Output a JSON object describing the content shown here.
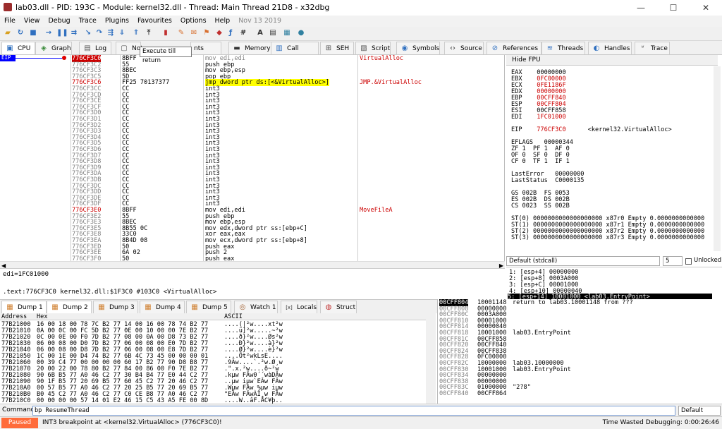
{
  "window": {
    "title": "lab03.dll - PID: 193C - Module: kernel32.dll - Thread: Main Thread 21D8 - x32dbg",
    "min": "—",
    "max": "☐",
    "close": "✕"
  },
  "menu": [
    "File",
    "View",
    "Debug",
    "Trace",
    "Plugins",
    "Favourites",
    "Options",
    "Help"
  ],
  "menu_date": "Nov 13 2019",
  "tooltip": "Execute till return",
  "tabs": [
    {
      "label": "CPU",
      "icon": "cpu-icon"
    },
    {
      "label": "Graph",
      "icon": "graph-icon"
    },
    {
      "label": "Log",
      "icon": "log-icon"
    },
    {
      "label": "Not",
      "icon": "notes-icon"
    },
    {
      "label": "nts",
      "icon": "breakpoints-icon"
    },
    {
      "label": "Memory Map",
      "icon": "memory-map-icon"
    },
    {
      "label": "Call Stack",
      "icon": "call-stack-icon"
    },
    {
      "label": "SEH",
      "icon": "seh-icon"
    },
    {
      "label": "Script",
      "icon": "script-icon"
    },
    {
      "label": "Symbols",
      "icon": "symbols-icon"
    },
    {
      "label": "Source",
      "icon": "source-icon"
    },
    {
      "label": "References",
      "icon": "references-icon"
    },
    {
      "label": "Threads",
      "icon": "threads-icon"
    },
    {
      "label": "Handles",
      "icon": "handles-icon"
    },
    {
      "label": "Trace",
      "icon": "trace-icon"
    }
  ],
  "eip_label": "EIP",
  "disasm": [
    {
      "addr": "776CF3C0",
      "bytes": "8BFF",
      "ins": "mov edi,edi",
      "cmt": "VirtualAlloc"
    },
    {
      "addr": "776CF3C2",
      "bytes": "55",
      "ins": "push ebp",
      "cmt": ""
    },
    {
      "addr": "776CF3C3",
      "bytes": "8BEC",
      "ins": "mov ebp,esp",
      "cmt": ""
    },
    {
      "addr": "776CF3C5",
      "bytes": "5D",
      "ins": "pop ebp",
      "cmt": ""
    },
    {
      "addr": "776CF3C6",
      "bytes": "FF25 70137377",
      "ins": "jmp dword ptr ds:[<&VirtualAlloc>]",
      "cmt": "JMP.&VirtualAlloc"
    },
    {
      "addr": "776CF3CC",
      "bytes": "CC",
      "ins": "int3",
      "cmt": ""
    },
    {
      "addr": "776CF3CD",
      "bytes": "CC",
      "ins": "int3",
      "cmt": ""
    },
    {
      "addr": "776CF3CE",
      "bytes": "CC",
      "ins": "int3",
      "cmt": ""
    },
    {
      "addr": "776CF3CF",
      "bytes": "CC",
      "ins": "int3",
      "cmt": ""
    },
    {
      "addr": "776CF3D0",
      "bytes": "CC",
      "ins": "int3",
      "cmt": ""
    },
    {
      "addr": "776CF3D1",
      "bytes": "CC",
      "ins": "int3",
      "cmt": ""
    },
    {
      "addr": "776CF3D2",
      "bytes": "CC",
      "ins": "int3",
      "cmt": ""
    },
    {
      "addr": "776CF3D3",
      "bytes": "CC",
      "ins": "int3",
      "cmt": ""
    },
    {
      "addr": "776CF3D4",
      "bytes": "CC",
      "ins": "int3",
      "cmt": ""
    },
    {
      "addr": "776CF3D5",
      "bytes": "CC",
      "ins": "int3",
      "cmt": ""
    },
    {
      "addr": "776CF3D6",
      "bytes": "CC",
      "ins": "int3",
      "cmt": ""
    },
    {
      "addr": "776CF3D7",
      "bytes": "CC",
      "ins": "int3",
      "cmt": ""
    },
    {
      "addr": "776CF3D8",
      "bytes": "CC",
      "ins": "int3",
      "cmt": ""
    },
    {
      "addr": "776CF3D9",
      "bytes": "CC",
      "ins": "int3",
      "cmt": ""
    },
    {
      "addr": "776CF3DA",
      "bytes": "CC",
      "ins": "int3",
      "cmt": ""
    },
    {
      "addr": "776CF3DB",
      "bytes": "CC",
      "ins": "int3",
      "cmt": ""
    },
    {
      "addr": "776CF3DC",
      "bytes": "CC",
      "ins": "int3",
      "cmt": ""
    },
    {
      "addr": "776CF3DD",
      "bytes": "CC",
      "ins": "int3",
      "cmt": ""
    },
    {
      "addr": "776CF3DE",
      "bytes": "CC",
      "ins": "int3",
      "cmt": ""
    },
    {
      "addr": "776CF3DF",
      "bytes": "CC",
      "ins": "int3",
      "cmt": ""
    },
    {
      "addr": "776CF3E0",
      "bytes": "8BFF",
      "ins": "mov edi,edi",
      "cmt": "MoveFileA"
    },
    {
      "addr": "776CF3E2",
      "bytes": "55",
      "ins": "push ebp",
      "cmt": ""
    },
    {
      "addr": "776CF3E3",
      "bytes": "8BEC",
      "ins": "mov ebp,esp",
      "cmt": ""
    },
    {
      "addr": "776CF3E5",
      "bytes": "8B55 0C",
      "ins": "mov edx,dword ptr ss:[ebp+C]",
      "cmt": ""
    },
    {
      "addr": "776CF3E8",
      "bytes": "33C0",
      "ins": "xor eax,eax",
      "cmt": ""
    },
    {
      "addr": "776CF3EA",
      "bytes": "8B4D 08",
      "ins": "mov ecx,dword ptr ss:[ebp+8]",
      "cmt": ""
    },
    {
      "addr": "776CF3ED",
      "bytes": "50",
      "ins": "push eax",
      "cmt": ""
    },
    {
      "addr": "776CF3EE",
      "bytes": "6A 02",
      "ins": "push 2",
      "cmt": ""
    },
    {
      "addr": "776CF3F0",
      "bytes": "50",
      "ins": "push eax",
      "cmt": ""
    }
  ],
  "info": {
    "line1": "edi=1FC01000",
    "line2": ".text:776CF3C0 kernel32.dll:$1F3C0 #103C0 <VirtualAlloc>"
  },
  "regs_header": "Hide FPU",
  "regs": [
    {
      "n": "EAX",
      "v": "00000000",
      "red": false
    },
    {
      "n": "EBX",
      "v": "0FC00000",
      "red": true
    },
    {
      "n": "ECX",
      "v": "0FE1186F",
      "red": true
    },
    {
      "n": "EDX",
      "v": "00000000",
      "red": true
    },
    {
      "n": "EBP",
      "v": "00CFF840",
      "red": true
    },
    {
      "n": "ESP",
      "v": "00CFF804",
      "red": true
    },
    {
      "n": "ESI",
      "v": "00CFF858",
      "red": false
    },
    {
      "n": "EDI",
      "v": "1FC01000",
      "red": true
    }
  ],
  "eip": {
    "n": "EIP",
    "v": "776CF3C0",
    "sym": "<kernel32.VirtualAlloc>"
  },
  "eflags": {
    "label": "EFLAGS",
    "v": "00000344"
  },
  "flags": [
    "ZF 1  PF 1  AF 0",
    "OF 0  SF 0  DF 0",
    "CF 0  TF 1  IF 1"
  ],
  "lasterr": [
    "LastError   00000000",
    "LastStatus  C0000135"
  ],
  "segs": [
    "GS 002B  FS 0053",
    "ES 002B  DS 002B",
    "CS 0023  SS 002B"
  ],
  "fpu": [
    "ST(0) 0000000000000000000 x87r0 Empty 0.0000000000000",
    "ST(1) 0000000000000000000 x87r1 Empty 0.0000000000000",
    "ST(2) 0000000000000000000 x87r2 Empty 0.0000000000000",
    "ST(3) 0000000000000000000 x87r3 Empty 0.0000000000000"
  ],
  "callconv": {
    "label": "Default (stdcall)",
    "num": "5",
    "unlocked": "Unlocked"
  },
  "stackargs": [
    "1: [esp+4] 00000000",
    "2: [esp+8] 0003A000",
    "3: [esp+C] 00001000",
    "4: [esp+10] 00000040",
    "5: [esp+14] 10001000 <lab03.EntryPoint>"
  ],
  "dump_tabs": [
    {
      "label": "Dump 1",
      "icon": "dump-icon"
    },
    {
      "label": "Dump 2",
      "icon": "dump-icon"
    },
    {
      "label": "Dump 3",
      "icon": "dump-icon"
    },
    {
      "label": "Dump 4",
      "icon": "dump-icon"
    },
    {
      "label": "Dump 5",
      "icon": "dump-icon"
    },
    {
      "label": "Watch 1",
      "icon": "watch-icon"
    },
    {
      "label": "Locals",
      "icon": "locals-icon"
    },
    {
      "label": "Struct",
      "icon": "struct-icon"
    }
  ],
  "dump_header": {
    "addr": "Address",
    "hex": "Hex",
    "ascii": "ASCII"
  },
  "dump": [
    {
      "a": "77B21000",
      "h": "16 00 18 00 78 7C B2 77 14 00 16 00 78 74 B2 77",
      "s": "....(|²w....xt²w"
    },
    {
      "a": "77B21010",
      "h": "0A 00 0C 00 FC 5D B2 77 0E 00 10 00 00 7E B2 77",
      "s": "....ü]²w.....~²w"
    },
    {
      "a": "77B21020",
      "h": "0C 00 0E 00 F0 7D B2 77 08 00 0A 00 D8 73 B2 77",
      "s": "....ð}²w....Øs²w"
    },
    {
      "a": "77B21030",
      "h": "06 00 08 00 D0 7D B2 77 06 00 08 00 E0 7D B2 77",
      "s": "....Ð}²w....à}²w"
    },
    {
      "a": "77B21040",
      "h": "06 00 08 00 D8 7D B2 77 06 00 08 00 E8 7D B2 77",
      "s": "....Ø}²w....è}²w"
    },
    {
      "a": "77B21050",
      "h": "1C 00 1E 00 D4 74 B2 77 6B 4C 73 45 00 00 00 01",
      "s": "....Ôt²wkLsE...."
    },
    {
      "a": "77B21060",
      "h": "00 39 C4 77 00 00 00 00 60 17 B2 77 90 D8 B8 77",
      "s": ".9Äw....`.²w.Ø¸w"
    },
    {
      "a": "77B21070",
      "h": "20 00 22 00 78 80 B2 77 84 00 86 00 F0 7E B2 77",
      "s": " .\".x.²w....ð~²w"
    },
    {
      "a": "77B21080",
      "h": "90 6B B5 77 A0 46 C2 77 30 B4 B4 77 E0 44 C2 77",
      "s": ".kµw FÂw0´´wàDÂw"
    },
    {
      "a": "77B21090",
      "h": "90 1F B5 77 20 69 B5 77 60 45 C2 77 20 46 C2 77",
      "s": "..µw iµw`EÂw FÂw"
    },
    {
      "a": "77B210A0",
      "h": "00 57 B5 77 A0 46 C2 77 20 25 B5 77 20 69 B5 77",
      "s": ".Wµw FÂw %µw iµw"
    },
    {
      "a": "77B210B0",
      "h": "B0 45 C2 77 A0 46 C2 77 C0 CE B8 77 A0 46 C2 77",
      "s": "°EÂw FÂwÀÎ¸w FÂw"
    },
    {
      "a": "77B210C0",
      "h": "00 00 00 00 57 14 01 E2 46 15 C5 43 A5 FE 00 8D",
      "s": "....W..âF.ÅC¥þ.."
    }
  ],
  "stack": [
    {
      "a": "00CFF804",
      "v": "10001148",
      "c": "return to lab03.10001148 from ???",
      "red": true
    },
    {
      "a": "00CFF808",
      "v": "00000000",
      "c": "",
      "red": false
    },
    {
      "a": "00CFF80C",
      "v": "0003A000",
      "c": "",
      "red": false
    },
    {
      "a": "00CFF810",
      "v": "00001000",
      "c": "",
      "red": false
    },
    {
      "a": "00CFF814",
      "v": "00000040",
      "c": "",
      "red": false
    },
    {
      "a": "00CFF818",
      "v": "10001000",
      "c": "lab03.EntryPoint",
      "red": false
    },
    {
      "a": "00CFF81C",
      "v": "00CFF858",
      "c": "",
      "red": false
    },
    {
      "a": "00CFF820",
      "v": "00CFF840",
      "c": "",
      "red": false
    },
    {
      "a": "00CFF824",
      "v": "00CFF838",
      "c": "",
      "red": false
    },
    {
      "a": "00CFF828",
      "v": "0FC00000",
      "c": "",
      "red": false
    },
    {
      "a": "00CFF82C",
      "v": "10000000",
      "c": "lab03.10000000",
      "red": false
    },
    {
      "a": "00CFF830",
      "v": "10001000",
      "c": "lab03.EntryPoint",
      "red": false
    },
    {
      "a": "00CFF834",
      "v": "00000000",
      "c": "",
      "red": false
    },
    {
      "a": "00CFF838",
      "v": "00000000",
      "c": "",
      "red": false
    },
    {
      "a": "00CFF83C",
      "v": "01000000",
      "c": "\"2?8\"",
      "red": false
    },
    {
      "a": "00CFF840",
      "v": "00CFF864",
      "c": "",
      "red": false
    }
  ],
  "command": {
    "label": "Command:",
    "value": "bp ResumeThread",
    "mode": "Default"
  },
  "status": {
    "state": "Paused",
    "msg": "INT3 breakpoint at <kernel32.VirtualAlloc> (776CF3C0)!",
    "time": "Time Wasted Debugging: 0:00:26:46"
  },
  "colors": {
    "paused": "#ff6b3a",
    "eip_bg": "#000000",
    "highlight_yellow": "#ffff00",
    "comment_red": "#cc0000"
  }
}
